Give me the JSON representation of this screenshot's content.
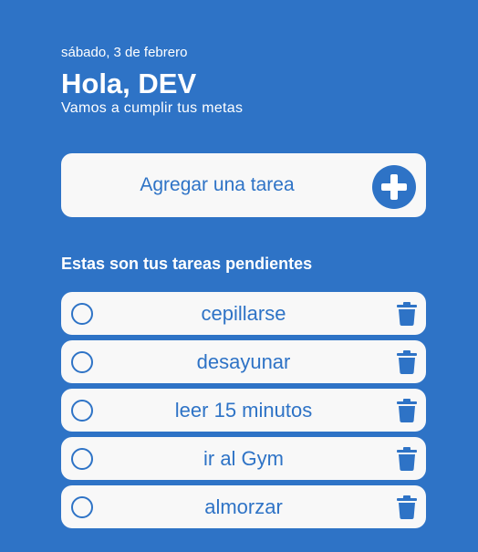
{
  "header": {
    "date": "sábado, 3 de febrero",
    "greeting": "Hola, DEV",
    "subtitle": "Vamos a cumplir tus metas"
  },
  "add_task": {
    "label": "Agregar una tarea",
    "icon": "plus-circle-icon"
  },
  "section_title": "Estas son tus tareas pendientes",
  "tasks": [
    {
      "text": "cepillarse",
      "completed": false
    },
    {
      "text": "desayunar",
      "completed": false
    },
    {
      "text": "leer 15 minutos",
      "completed": false
    },
    {
      "text": "ir al Gym",
      "completed": false
    },
    {
      "text": "almorzar",
      "completed": false
    }
  ],
  "icons": {
    "check": "circle-checkbox-icon",
    "delete": "trash-icon"
  },
  "colors": {
    "background": "#2e73c6",
    "card": "#f8f8f8",
    "accent": "#2e73c6",
    "text_light": "#ffffff"
  }
}
